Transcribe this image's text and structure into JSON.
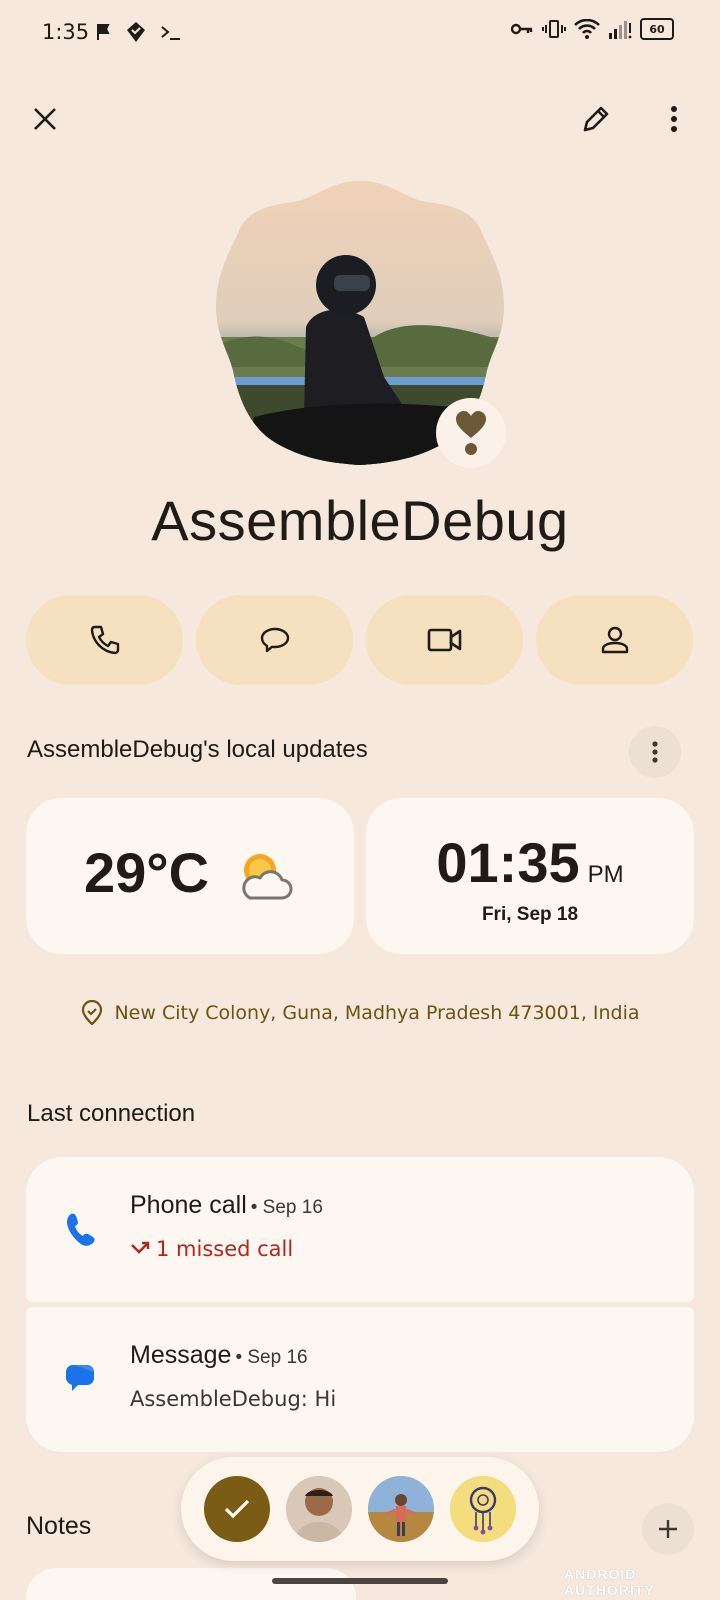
{
  "status_bar": {
    "time": "1:35",
    "battery": "60"
  },
  "contact": {
    "name": "AssembleDebug"
  },
  "local_updates": {
    "title": "AssembleDebug's local updates",
    "weather": {
      "temperature": "29°C",
      "icon": "partly-cloudy-icon"
    },
    "clock": {
      "time": "01:35",
      "ampm": "PM",
      "date": "Fri, Sep 18"
    },
    "location": "New City Colony, Guna, Madhya Pradesh 473001, India"
  },
  "last_connection": {
    "title": "Last connection",
    "items": [
      {
        "title": "Phone call",
        "date": "• Sep 16",
        "detail": "1 missed call"
      },
      {
        "title": "Message",
        "date": "• Sep 16",
        "sender": "AssembleDebug:",
        "text": "Hi"
      }
    ]
  },
  "notes": {
    "title": "Notes"
  },
  "watermark": "ANDROID AUTHORITY",
  "colors": {
    "background": "#f6e8dc",
    "action_button": "#f5e0bf",
    "card": "#fdf7f2",
    "missed_call": "#b3261e",
    "location_text": "#6b5310",
    "phone_blue": "#1a73e8"
  }
}
